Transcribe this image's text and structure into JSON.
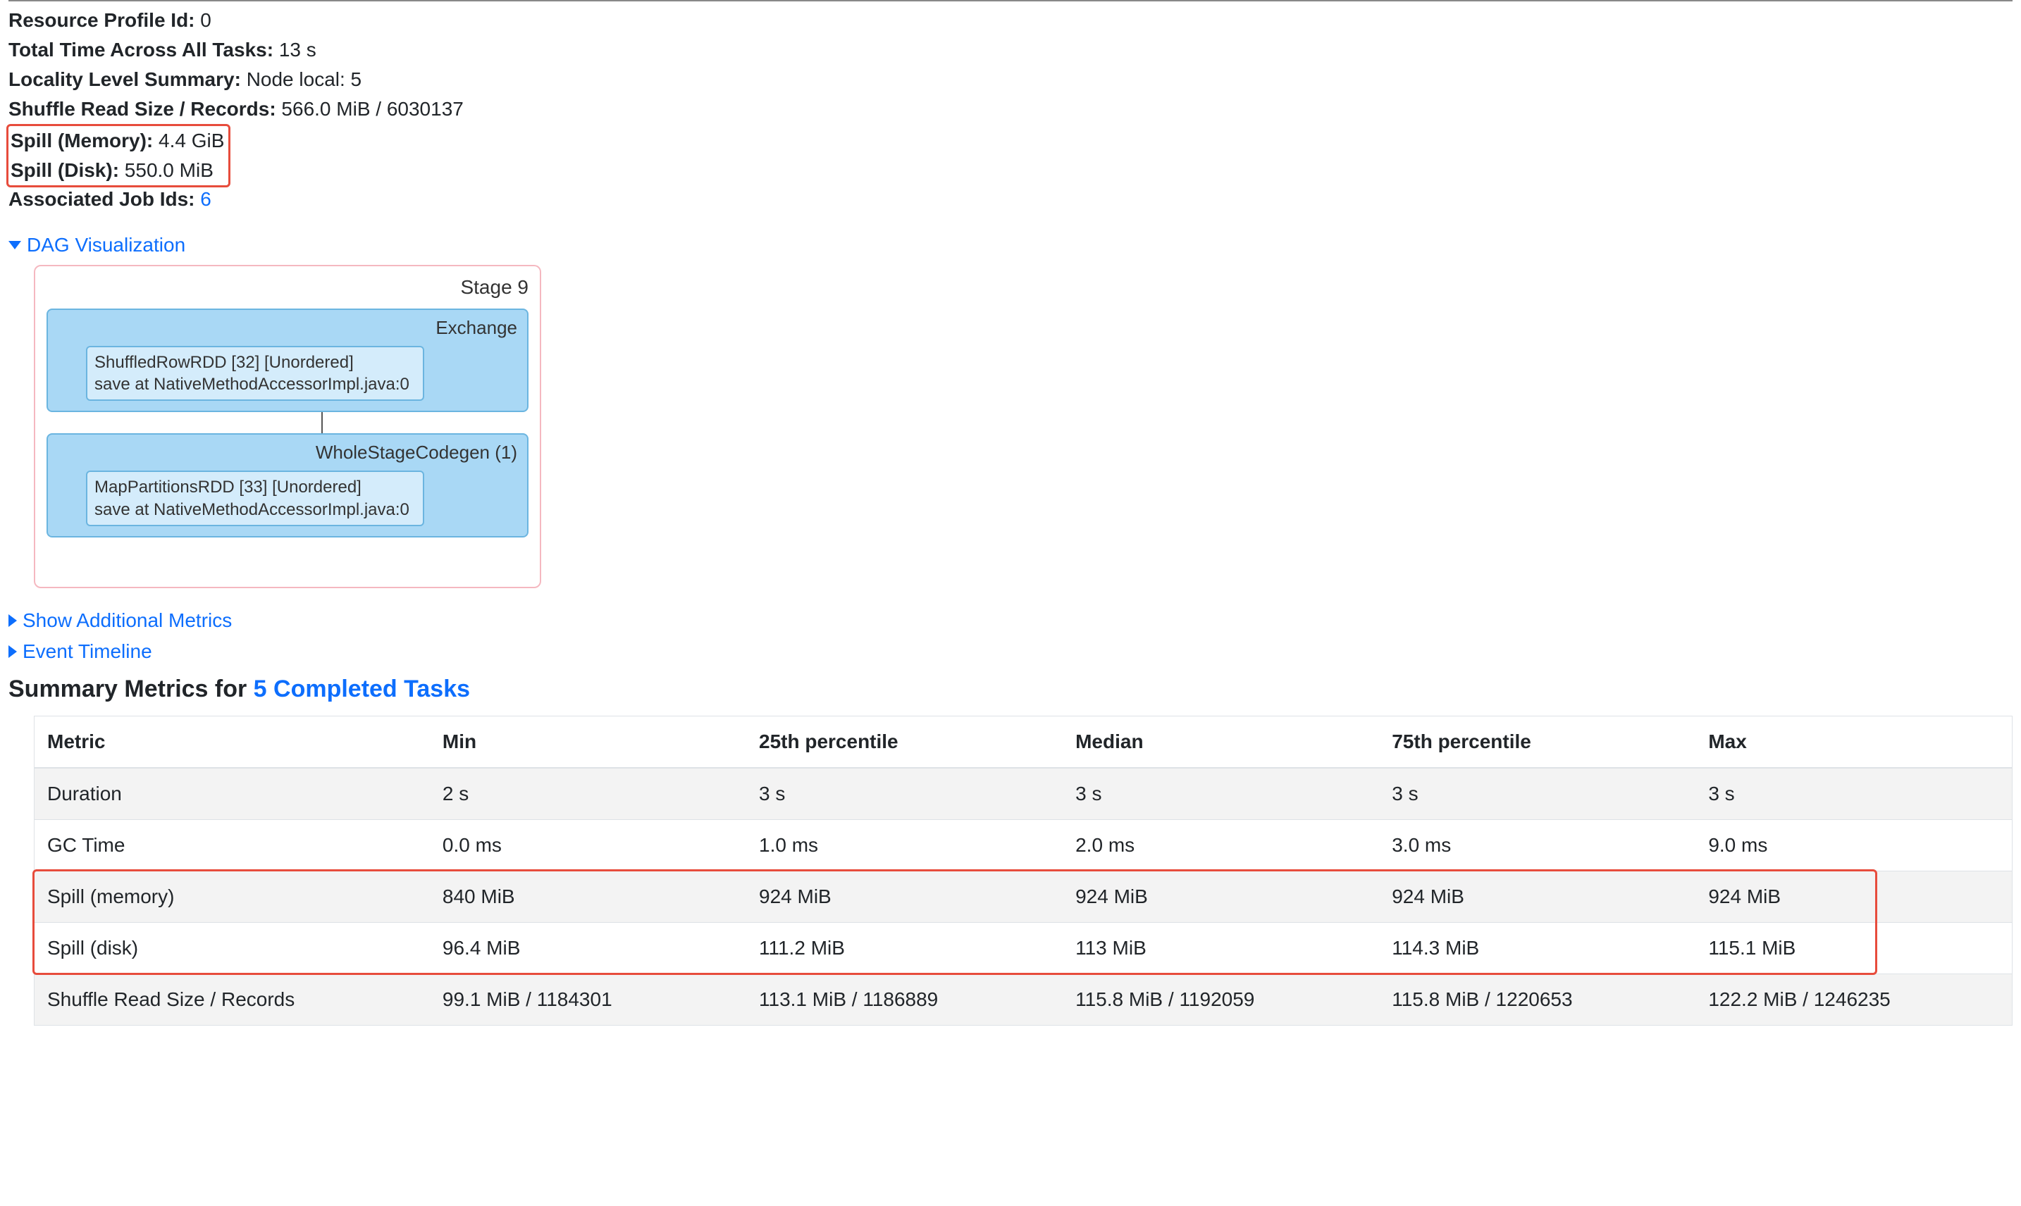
{
  "summary": {
    "resource_profile_label": "Resource Profile Id:",
    "resource_profile_value": "0",
    "total_time_label": "Total Time Across All Tasks:",
    "total_time_value": "13 s",
    "locality_label": "Locality Level Summary:",
    "locality_value": "Node local: 5",
    "shuffle_read_label": "Shuffle Read Size / Records:",
    "shuffle_read_value": "566.0 MiB / 6030137",
    "spill_mem_label": "Spill (Memory):",
    "spill_mem_value": "4.4 GiB",
    "spill_disk_label": "Spill (Disk):",
    "spill_disk_value": "550.0 MiB",
    "assoc_label": "Associated Job Ids:",
    "assoc_link": "6"
  },
  "collapsibles": {
    "dag": "DAG Visualization",
    "additional_metrics": "Show Additional Metrics",
    "event_timeline": "Event Timeline"
  },
  "dag": {
    "stage_title": "Stage 9",
    "block1_title": "Exchange",
    "block1_line1": "ShuffledRowRDD [32] [Unordered]",
    "block1_line2": "save at NativeMethodAccessorImpl.java:0",
    "block2_title": "WholeStageCodegen (1)",
    "block2_line1": "MapPartitionsRDD [33] [Unordered]",
    "block2_line2": "save at NativeMethodAccessorImpl.java:0"
  },
  "metrics_heading_prefix": "Summary Metrics for ",
  "metrics_heading_link": "5 Completed Tasks",
  "table": {
    "headers": [
      "Metric",
      "Min",
      "25th percentile",
      "Median",
      "75th percentile",
      "Max"
    ],
    "rows": [
      [
        "Duration",
        "2 s",
        "3 s",
        "3 s",
        "3 s",
        "3 s"
      ],
      [
        "GC Time",
        "0.0 ms",
        "1.0 ms",
        "2.0 ms",
        "3.0 ms",
        "9.0 ms"
      ],
      [
        "Spill (memory)",
        "840 MiB",
        "924 MiB",
        "924 MiB",
        "924 MiB",
        "924 MiB"
      ],
      [
        "Spill (disk)",
        "96.4 MiB",
        "111.2 MiB",
        "113 MiB",
        "114.3 MiB",
        "115.1 MiB"
      ],
      [
        "Shuffle Read Size / Records",
        "99.1 MiB / 1184301",
        "113.1 MiB / 1186889",
        "115.8 MiB / 1192059",
        "115.8 MiB / 1220653",
        "122.2 MiB / 1246235"
      ]
    ]
  }
}
